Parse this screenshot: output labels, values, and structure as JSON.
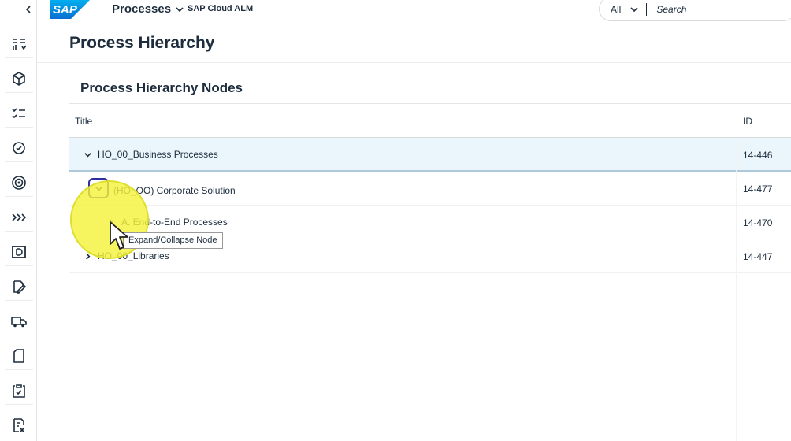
{
  "shell": {
    "app_title": "Processes",
    "product_name": "SAP Cloud ALM",
    "search_scope": "All",
    "search_placeholder": "Search",
    "brand_color": "#0a6ed1"
  },
  "rail": {
    "items": [
      {
        "icon": "hierarchy-chart-icon"
      },
      {
        "icon": "package-icon"
      },
      {
        "icon": "checklist-icon"
      },
      {
        "icon": "settings-check-icon"
      },
      {
        "icon": "target-icon"
      },
      {
        "icon": "chevrons-forward-icon"
      },
      {
        "icon": "document-frame-icon"
      },
      {
        "icon": "edit-document-icon"
      },
      {
        "icon": "truck-icon"
      },
      {
        "icon": "blank-document-icon"
      },
      {
        "icon": "clipboard-check-icon"
      },
      {
        "icon": "task-list-icon"
      }
    ]
  },
  "page": {
    "title": "Process Hierarchy"
  },
  "panel": {
    "title": "Process Hierarchy Nodes",
    "columns": {
      "title": "Title",
      "id": "ID"
    },
    "rows": [
      {
        "title": "HO_00_Business Processes",
        "id": "14-446",
        "level": 0,
        "expanded": true,
        "selected": true
      },
      {
        "title": "(HO_OO) Corporate Solution",
        "id": "14-477",
        "level": 1,
        "expanded": true,
        "selected": false
      },
      {
        "title": "A. End-to-End Processes",
        "id": "14-470",
        "level": 2,
        "expanded": false,
        "selected": false
      },
      {
        "title": "HO_00_Libraries",
        "id": "14-447",
        "level": 0,
        "expanded": false,
        "selected": false
      }
    ]
  },
  "tooltip": {
    "text": "Expand/Collapse Node"
  },
  "colors": {
    "selected_row": "#eaf6fb",
    "focus_ring": "#2f2fa0",
    "highlight": "#f4f23c"
  }
}
